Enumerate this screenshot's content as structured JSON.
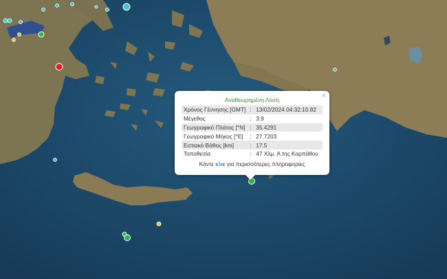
{
  "popup": {
    "title": "Αναθεωρημένη Λύση",
    "close_label": "×",
    "rows": [
      {
        "label": "Χρόνος Γέννησης [GMT]",
        "value": "13/02/2024 04:32:10.82"
      },
      {
        "label": "Μέγεθος",
        "value": "3.9"
      },
      {
        "label": "Γεωγραφικό Πλάτος [°N]",
        "value": "35.4291"
      },
      {
        "label": "Γεωγραφικό Μήκος [°E]",
        "value": "27.7203"
      },
      {
        "label": "Εστιακό Βάθος [km]",
        "value": "17.5"
      },
      {
        "label": "Τοποθεσία",
        "value": "47 Χλμ. Α της Καρπάθου"
      }
    ],
    "more_prefix": "Κάντε ",
    "more_link": "κλικ",
    "more_suffix": " για περισσότερες πληροφορίες"
  },
  "colors": {
    "sea": "#1f4d6e",
    "deep_sea": "#173f5e",
    "land": "#8a7a55",
    "land_dark": "#5f5a3c",
    "marker_green": "#2db84d",
    "marker_cyan": "#3fc9d4",
    "marker_yellow": "#e8c531",
    "marker_red": "#e0211d",
    "lake": "#2f4f8f"
  }
}
